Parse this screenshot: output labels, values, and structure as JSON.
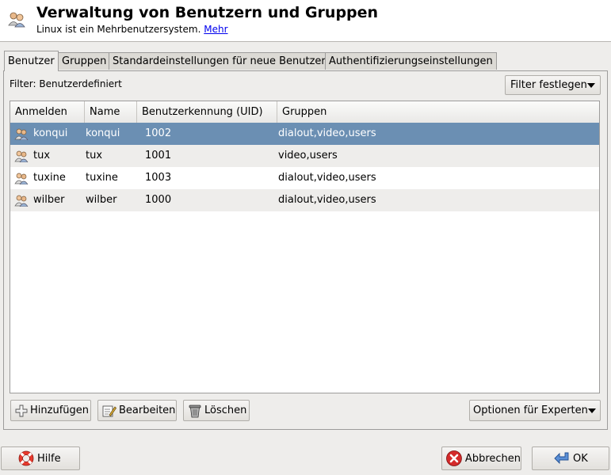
{
  "header": {
    "title": "Verwaltung von Benutzern und Gruppen",
    "subtitle": "Linux ist ein Mehrbenutzersystem.",
    "more_link": "Mehr"
  },
  "tabs": [
    {
      "label": "Benutzer",
      "active": true
    },
    {
      "label": "Gruppen",
      "active": false
    },
    {
      "label": "Standardeinstellungen für neue Benutzer",
      "active": false
    },
    {
      "label": "Authentifizierungseinstellungen",
      "active": false
    }
  ],
  "filter": {
    "label": "Filter: Benutzerdefiniert",
    "button_label": "Filter festlegen"
  },
  "table": {
    "columns": [
      "Anmelden",
      "Name",
      "Benutzerkennung (UID)",
      "Gruppen"
    ],
    "rows": [
      {
        "login": "konqui",
        "name": "konqui",
        "uid": "1002",
        "groups": "dialout,video,users",
        "selected": true
      },
      {
        "login": "tux",
        "name": "tux",
        "uid": "1001",
        "groups": "video,users",
        "selected": false
      },
      {
        "login": "tuxine",
        "name": "tuxine",
        "uid": "1003",
        "groups": "dialout,video,users",
        "selected": false
      },
      {
        "login": "wilber",
        "name": "wilber",
        "uid": "1000",
        "groups": "dialout,video,users",
        "selected": false
      }
    ]
  },
  "actions": {
    "add_label": "Hinzufügen",
    "edit_label": "Bearbeiten",
    "delete_label": "Löschen",
    "expert_label": "Optionen für Experten"
  },
  "footer": {
    "help_label": "Hilfe",
    "cancel_label": "Abbrechen",
    "ok_label": "OK"
  },
  "colors": {
    "selection": "#6b8fb3",
    "link": "#0000ee",
    "cancel_icon": "#d42a2a",
    "ok_icon": "#3a6ec9"
  },
  "icons": [
    "users-icon",
    "user-icon",
    "plus-icon",
    "edit-icon",
    "trash-icon",
    "lifebuoy-icon",
    "cancel-icon",
    "ok-arrow-icon"
  ]
}
